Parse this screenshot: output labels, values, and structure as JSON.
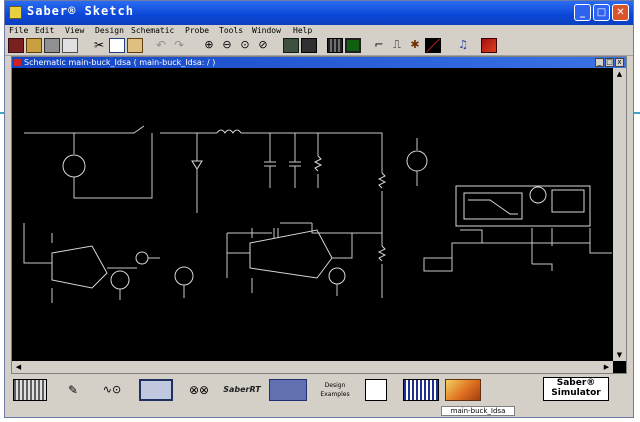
{
  "window": {
    "title": "Saber® Sketch",
    "min_glyph": "_",
    "max_glyph": "□",
    "close_glyph": "✕"
  },
  "menu": [
    {
      "id": "file",
      "label": "File"
    },
    {
      "id": "edit",
      "label": "Edit"
    },
    {
      "id": "view",
      "label": "View"
    },
    {
      "id": "design",
      "label": "Design"
    },
    {
      "id": "schematic",
      "label": "Schematic"
    },
    {
      "id": "probe",
      "label": "Probe"
    },
    {
      "id": "tools",
      "label": "Tools"
    },
    {
      "id": "window",
      "label": "Window"
    },
    {
      "id": "help",
      "label": "Help"
    }
  ],
  "toolbar": {
    "icons": [
      "new-icon",
      "open-icon",
      "save-icon",
      "print-icon",
      "cut-icon",
      "copy-icon",
      "paste-icon",
      "undo-icon",
      "redo-icon",
      "zoom-in-icon",
      "zoom-out-icon",
      "zoom-fit-icon",
      "zoom-area-icon",
      "netlist-icon",
      "simulate-icon",
      "grid-icon",
      "display-icon",
      "wire-icon",
      "step-icon",
      "probe-icon",
      "measure-icon",
      "run-icon",
      "stop-icon"
    ]
  },
  "schematic_window": {
    "title": "Schematic main-buck_Idsa ( main-buck_Idsa: / )",
    "btn_min": "_",
    "btn_max": "□",
    "btn_close": "x"
  },
  "bottom_toolbar": {
    "design_label": "Design",
    "examples_label": "Examples",
    "saber_rt": "SaberRT",
    "saber_badge_line1": "Saber®",
    "saber_badge_line2": "Simulator"
  },
  "statusbar": {
    "design_name": "main-buck_Idsa"
  },
  "colors": {
    "titlebar": "#0a46d6",
    "canvas": "#000000",
    "accent": "#41a6c8"
  }
}
